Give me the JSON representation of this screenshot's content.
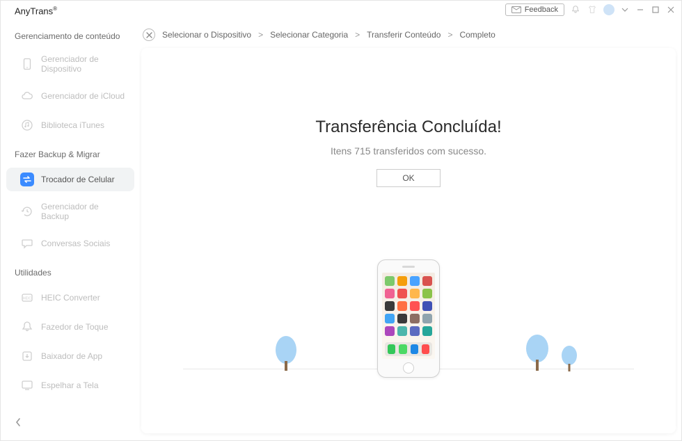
{
  "titlebar": {
    "brand": "AnyTrans",
    "brand_mark": "®",
    "feedback_label": "Feedback"
  },
  "sidebar": {
    "section_content": "Gerenciamento de conteúdo",
    "items_content": [
      {
        "label": "Gerenciador de Dispositivo"
      },
      {
        "label": "Gerenciador de iCloud"
      },
      {
        "label": "Biblioteca iTunes"
      }
    ],
    "section_backup": "Fazer Backup & Migrar",
    "items_backup": [
      {
        "label": "Trocador de Celular"
      },
      {
        "label": "Gerenciador de Backup"
      },
      {
        "label": "Conversas Sociais"
      }
    ],
    "section_util": "Utilidades",
    "items_util": [
      {
        "label": "HEIC Converter"
      },
      {
        "label": "Fazedor de Toque"
      },
      {
        "label": "Baixador de App"
      },
      {
        "label": "Espelhar a Tela"
      }
    ]
  },
  "breadcrumb": {
    "step1": "Selecionar o Dispositivo",
    "step2": "Selecionar Categoria",
    "step3": "Transferir Conteúdo",
    "step4": "Completo"
  },
  "result": {
    "title": "Transferência Concluída!",
    "subtitle": "Itens 715 transferidos com sucesso.",
    "ok": "OK"
  },
  "icon_colors": {
    "row1": [
      "#7dc96b",
      "#f59e0b",
      "#4aa3ff",
      "#d9534f"
    ],
    "row2": [
      "#f06292",
      "#ef5350",
      "#ffb74d",
      "#8bc34a"
    ],
    "row3": [
      "#3a3a3a",
      "#ff7043",
      "#ff5252",
      "#3f51b5"
    ],
    "row4": [
      "#42a5f5",
      "#3a3a3a",
      "#8d6e63",
      "#90a4ae"
    ],
    "row5": [
      "#ac47bc",
      "#4db6ac",
      "#5c6bc0",
      "#26a69a"
    ],
    "dock": [
      "#34c759",
      "#4cd964",
      "#1e88e5",
      "#ff4d4d"
    ]
  }
}
